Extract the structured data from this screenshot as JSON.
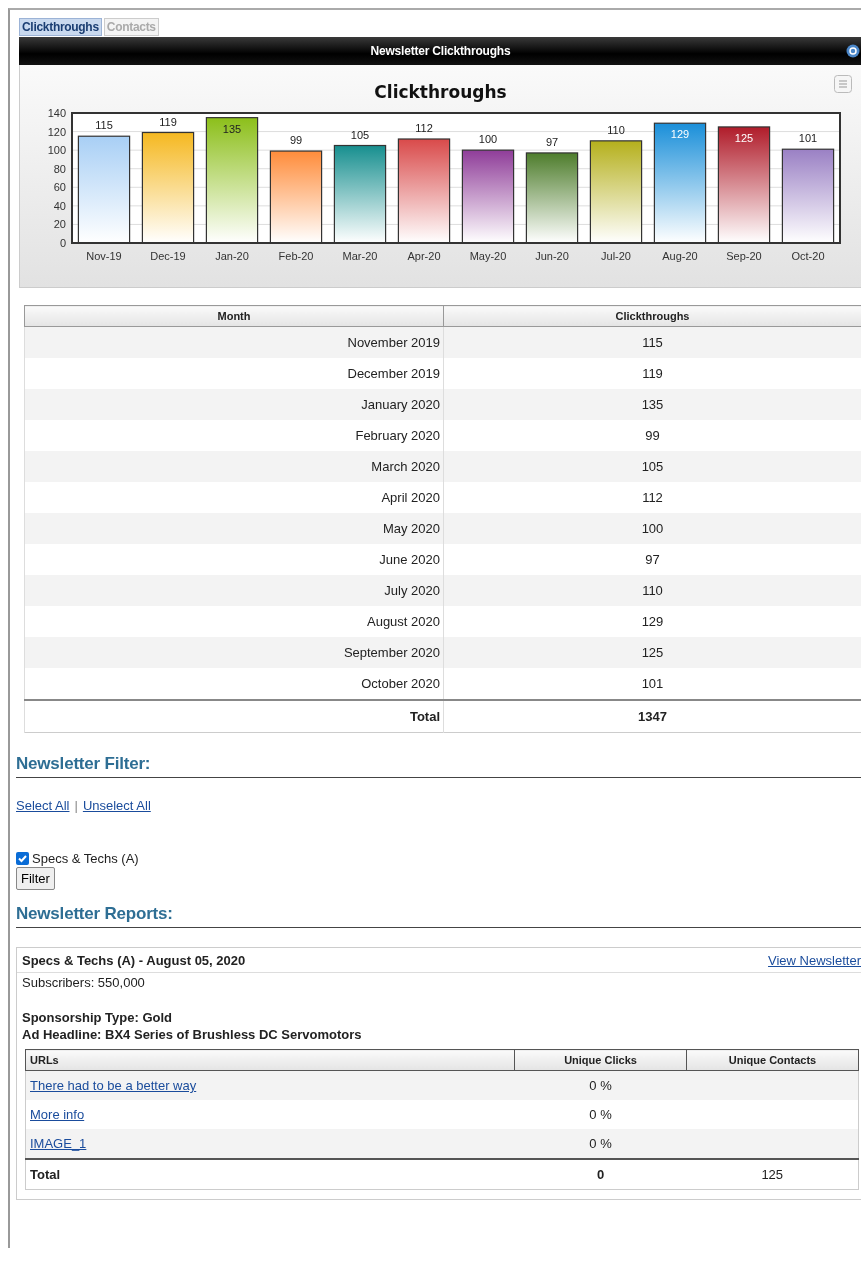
{
  "tabs": [
    {
      "label": "Clickthroughs",
      "selected": true
    },
    {
      "label": "Contacts",
      "selected": false
    }
  ],
  "panel": {
    "title": "Newsletter Clickthroughs",
    "chart_data": {
      "type": "bar",
      "title": "Clickthroughs",
      "categories": [
        "Nov-19",
        "Dec-19",
        "Jan-20",
        "Feb-20",
        "Mar-20",
        "Apr-20",
        "May-20",
        "Jun-20",
        "Jul-20",
        "Aug-20",
        "Sep-20",
        "Oct-20"
      ],
      "series": [
        {
          "values": [
            115,
            119,
            135,
            99,
            105,
            112,
            100,
            97,
            110,
            129,
            125,
            101
          ]
        }
      ],
      "ylim": [
        0,
        140
      ],
      "yticks": [
        0,
        20,
        40,
        60,
        80,
        100,
        120,
        140
      ],
      "data_labels": true,
      "grid": true
    }
  },
  "table": {
    "columns": [
      "Month",
      "Clickthroughs"
    ],
    "rows": [
      [
        "November 2019",
        "115"
      ],
      [
        "December 2019",
        "119"
      ],
      [
        "January 2020",
        "135"
      ],
      [
        "February 2020",
        "99"
      ],
      [
        "March 2020",
        "105"
      ],
      [
        "April 2020",
        "112"
      ],
      [
        "May 2020",
        "100"
      ],
      [
        "June 2020",
        "97"
      ],
      [
        "July 2020",
        "110"
      ],
      [
        "August 2020",
        "129"
      ],
      [
        "September 2020",
        "125"
      ],
      [
        "October 2020",
        "101"
      ]
    ],
    "total": [
      "Total",
      "1347"
    ]
  },
  "filter": {
    "heading": "Newsletter Filter:",
    "links": [
      "Select All",
      "Unselect All"
    ],
    "separator": "|",
    "newsletters": [
      {
        "label": "Specs & Techs (A)",
        "checked": true
      }
    ],
    "button": "Filter"
  },
  "reports": {
    "heading": "Newsletter Reports:",
    "items": [
      {
        "title": "Specs & Techs (A) - August 05, 2020",
        "link": "View Newsletter",
        "subscribers": "Subscribers: 550,000",
        "sponsorship": "Sponsorship Type: Gold",
        "headline": "Ad Headline: BX4 Series of Brushless DC Servomotors",
        "columns": [
          "URLs",
          "Unique Clicks",
          "Unique Contacts"
        ],
        "rows": [
          {
            "url": "There had to be a better way",
            "clicks": "0 %"
          },
          {
            "url": "More info",
            "clicks": "0 %"
          },
          {
            "url": "IMAGE_1",
            "clicks": "0 %"
          }
        ],
        "total": [
          "Total",
          "0",
          "125"
        ]
      }
    ]
  }
}
